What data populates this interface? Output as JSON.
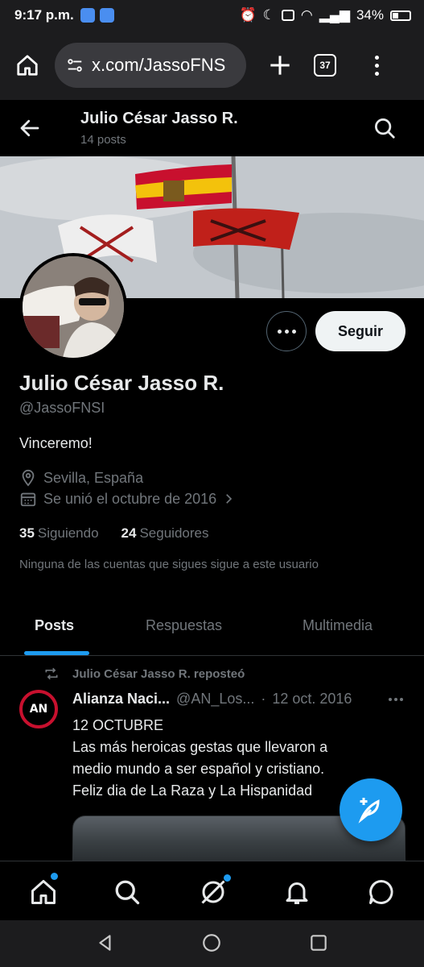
{
  "status_bar": {
    "time": "9:17 p.m.",
    "battery": "34%"
  },
  "browser": {
    "url": "x.com/JassoFNS",
    "tab_count": "37"
  },
  "header": {
    "name": "Julio César Jasso R.",
    "posts_count": "14 posts"
  },
  "profile": {
    "name": "Julio César Jasso R.",
    "handle": "@JassoFNSI",
    "bio": "Vinceremo!",
    "location": "Sevilla, España",
    "joined": "Se unió el octubre de 2016",
    "following_count": "35",
    "following_label": "Siguiendo",
    "followers_count": "24",
    "followers_label": "Seguidores",
    "no_follow_note": "Ninguna de las cuentas que sigues sigue a este usuario",
    "follow_button": "Seguir"
  },
  "tabs": [
    {
      "label": "Posts",
      "active": true
    },
    {
      "label": "Respuestas",
      "active": false
    },
    {
      "label": "Multimedia",
      "active": false
    }
  ],
  "tweet": {
    "repost_note": "Julio César Jasso R. reposteó",
    "avatar_text": "AN",
    "author_name": "Alianza Naci...",
    "author_handle": "@AN_Los...",
    "separator": "·",
    "date": "12 oct. 2016",
    "text_lines": [
      "12 OCTUBRE",
      "Las más heroicas gestas que llevaron a",
      "medio mundo a ser español y cristiano.",
      "Feliz dia de La Raza y La Hispanidad"
    ]
  },
  "colors": {
    "accent": "#1d9bf0",
    "background": "#000000",
    "muted": "#71767b",
    "text": "#e7e9ea"
  }
}
